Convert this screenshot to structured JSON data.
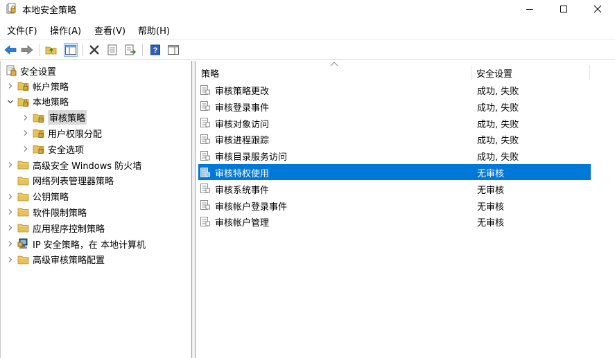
{
  "window": {
    "title": "本地安全策略"
  },
  "menu": [
    {
      "label": "文件(F)"
    },
    {
      "label": "操作(A)"
    },
    {
      "label": "查看(V)"
    },
    {
      "label": "帮助(H)"
    }
  ],
  "tree": {
    "root": {
      "label": "安全设置"
    },
    "items": [
      {
        "label": "帐户策略",
        "level": 1,
        "expand": "collapsed",
        "icon": "folder-lock-icon"
      },
      {
        "label": "本地策略",
        "level": 1,
        "expand": "expanded",
        "icon": "folder-lock-icon"
      },
      {
        "label": "审核策略",
        "level": 2,
        "expand": "collapsed",
        "icon": "folder-lock-icon",
        "selected": true
      },
      {
        "label": "用户权限分配",
        "level": 2,
        "expand": "collapsed",
        "icon": "folder-lock-icon"
      },
      {
        "label": "安全选项",
        "level": 2,
        "expand": "collapsed",
        "icon": "folder-lock-icon"
      },
      {
        "label": "高级安全 Windows 防火墙",
        "level": 1,
        "expand": "collapsed",
        "icon": "folder-icon"
      },
      {
        "label": "网络列表管理器策略",
        "level": 1,
        "expand": "none",
        "icon": "folder-icon"
      },
      {
        "label": "公钥策略",
        "level": 1,
        "expand": "collapsed",
        "icon": "folder-icon"
      },
      {
        "label": "软件限制策略",
        "level": 1,
        "expand": "collapsed",
        "icon": "folder-icon"
      },
      {
        "label": "应用程序控制策略",
        "level": 1,
        "expand": "collapsed",
        "icon": "folder-icon"
      },
      {
        "label": "IP 安全策略，在 本地计算机",
        "level": 1,
        "expand": "collapsed",
        "icon": "ip-security-icon"
      },
      {
        "label": "高级审核策略配置",
        "level": 1,
        "expand": "collapsed",
        "icon": "folder-icon"
      }
    ]
  },
  "list": {
    "columns": [
      {
        "label": "策略"
      },
      {
        "label": "安全设置"
      }
    ],
    "rows": [
      {
        "name": "审核策略更改",
        "value": "成功, 失败"
      },
      {
        "name": "审核登录事件",
        "value": "成功, 失败"
      },
      {
        "name": "审核对象访问",
        "value": "成功, 失败"
      },
      {
        "name": "审核进程跟踪",
        "value": "成功, 失败"
      },
      {
        "name": "审核目录服务访问",
        "value": "成功, 失败"
      },
      {
        "name": "审核特权使用",
        "value": "无审核",
        "selected": true
      },
      {
        "name": "审核系统事件",
        "value": "无审核"
      },
      {
        "name": "审核帐户登录事件",
        "value": "无审核"
      },
      {
        "name": "审核帐户管理",
        "value": "无审核"
      }
    ]
  },
  "colors": {
    "selection": "#0078d7",
    "tree_selection": "#d9d9d9",
    "folder": "#e8c15a"
  }
}
